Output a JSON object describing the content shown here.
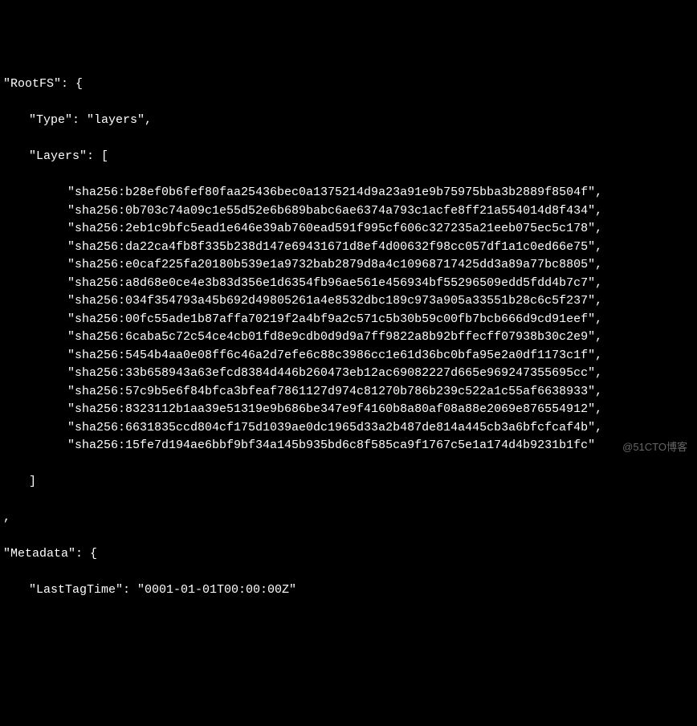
{
  "rootfs_key": "\"RootFS\": {",
  "type_line": "\"Type\": \"layers\",",
  "layers_open": "\"Layers\": [",
  "layers": [
    "\"sha256:b28ef0b6fef80faa25436bec0a1375214d9a23a91e9b75975bba3b2889f8504f\"",
    "\"sha256:0b703c74a09c1e55d52e6b689babc6ae6374a793c1acfe8ff21a554014d8f434\"",
    "\"sha256:2eb1c9bfc5ead1e646e39ab760ead591f995cf606c327235a21eeb075ec5c178\"",
    "\"sha256:da22ca4fb8f335b238d147e69431671d8ef4d00632f98cc057df1a1c0ed66e75\"",
    "\"sha256:e0caf225fa20180b539e1a9732bab2879d8a4c10968717425dd3a89a77bc8805\"",
    "\"sha256:a8d68e0ce4e3b83d356e1d6354fb96ae561e456934bf55296509edd5fdd4b7c7\"",
    "\"sha256:034f354793a45b692d49805261a4e8532dbc189c973a905a33551b28c6c5f237\"",
    "\"sha256:00fc55ade1b87affa70219f2a4bf9a2c571c5b30b59c00fb7bcb666d9cd91eef\"",
    "\"sha256:6caba5c72c54ce4cb01fd8e9cdb0d9d9a7ff9822a8b92bffecff07938b30c2e9\"",
    "\"sha256:5454b4aa0e08ff6c46a2d7efe6c88c3986cc1e61d36bc0bfa95e2a0df1173c1f\"",
    "\"sha256:33b658943a63efcd8384d446b260473eb12ac69082227d665e969247355695cc\"",
    "\"sha256:57c9b5e6f84bfca3bfeaf7861127d974c81270b786b239c522a1c55af6638933\"",
    "\"sha256:8323112b1aa39e51319e9b686be347e9f4160b8a80af08a88e2069e876554912\"",
    "\"sha256:6631835ccd804cf175d1039ae0dc1965d33a2b487de814a445cb3a6bfcfcaf4b\"",
    "\"sha256:15fe7d194ae6bbf9bf34a145b935bd6c8f585ca9f1767c5e1a174d4b9231b1fc\""
  ],
  "layers_close": "]",
  "comma_line": ",",
  "metadata_key": "\"Metadata\": {",
  "lasttagtime_line": "\"LastTagTime\": \"0001-01-01T00:00:00Z\"",
  "watermark": "@51CTO博客"
}
